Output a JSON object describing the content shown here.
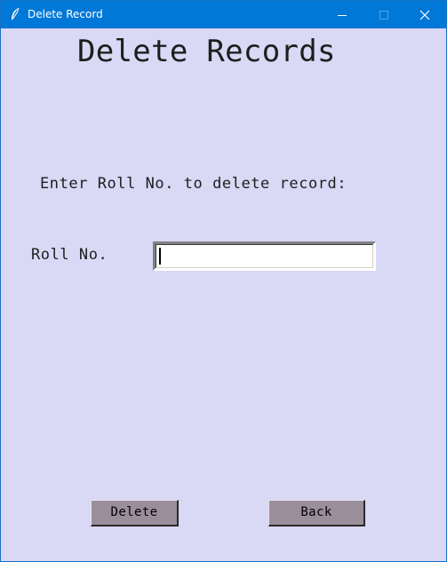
{
  "window": {
    "title": "Delete Record",
    "icons": {
      "app": "feather-icon",
      "minimize": "minimize-icon",
      "maximize": "maximize-icon",
      "close": "close-icon"
    },
    "colors": {
      "titlebar": "#0078d7",
      "background": "#d9d8f5",
      "button": "#9b8e9b"
    }
  },
  "form": {
    "heading": "Delete Records",
    "prompt": "Enter Roll No. to delete record:",
    "roll_label": "Roll No.",
    "roll_value": "",
    "delete_label": "Delete",
    "back_label": "Back"
  }
}
